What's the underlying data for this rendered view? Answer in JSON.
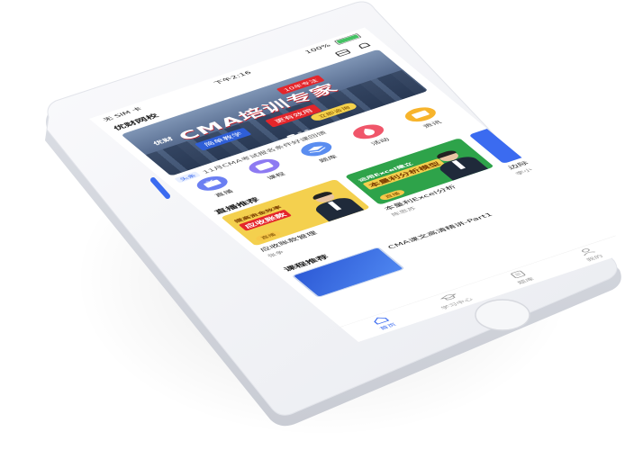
{
  "status_bar": {
    "carrier": "无 SIM 卡",
    "time": "下午2:16",
    "battery": "100%",
    "battery_level": 1.0
  },
  "app_title": "优财网校",
  "banner": {
    "main_text": "CMA培训专家",
    "prefix": "优财",
    "tag_red": "10年专注",
    "tag_a": "简单教学",
    "tag_b": "更有效用",
    "cta": "立即咨询"
  },
  "notice": {
    "badge": "头条",
    "text": "11月CMA考试报名条件好课回馈"
  },
  "quick_nav": [
    {
      "label": "直播",
      "icon": "tv-icon",
      "color": "#6b7ff2"
    },
    {
      "label": "课程",
      "icon": "play-icon",
      "color": "#8d7af2"
    },
    {
      "label": "题库",
      "icon": "stack-icon",
      "color": "#5a8df0"
    },
    {
      "label": "活动",
      "icon": "flame-icon",
      "color": "#f0566a"
    },
    {
      "label": "资讯",
      "icon": "news-icon",
      "color": "#f7b42c"
    }
  ],
  "live_section": {
    "title": "直播推荐"
  },
  "live_cards": [
    {
      "title": "应收账款管理",
      "teacher": "张争",
      "thumb_title": "提高资金效率",
      "thumb_sub": "应收账款",
      "pill": "直播",
      "bg": "#f4d04e",
      "sub_bg": "#e4262b"
    },
    {
      "title": "本量利Excel分析",
      "teacher": "陈思苏",
      "thumb_title": "运用Excel建立",
      "thumb_sub": "本量利分析模型",
      "pill": "直播",
      "bg": "#2ea34a",
      "sub_bg": "#f4d04e"
    },
    {
      "title": "边际",
      "teacher": "李小",
      "thumb_title": "",
      "thumb_sub": "",
      "pill": "",
      "bg": "#3b6bf0",
      "sub_bg": "#3b6bf0"
    }
  ],
  "course_section": {
    "title": "课程推荐"
  },
  "course_item": {
    "title": "CMA课文高清精讲-Part1"
  },
  "tabs": [
    {
      "label": "首页",
      "icon": "home-icon"
    },
    {
      "label": "学习中心",
      "icon": "graduation-cap-icon"
    },
    {
      "label": "题库",
      "icon": "clipboard-icon"
    },
    {
      "label": "我的",
      "icon": "user-icon"
    }
  ],
  "colors": {
    "accent": "#3b6bf0",
    "phone_body": "#f3f4f7",
    "banner_red": "#e4262b"
  }
}
